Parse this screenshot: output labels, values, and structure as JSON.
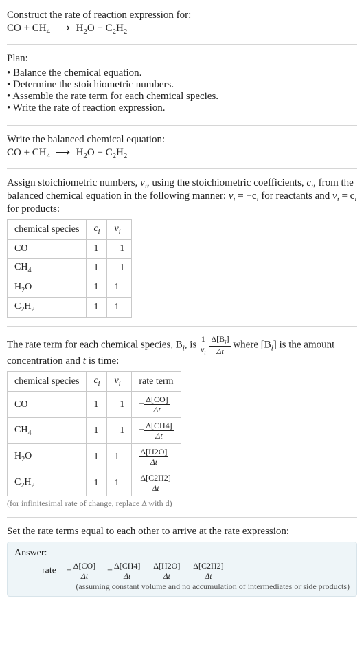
{
  "prompt": {
    "title": "Construct the rate of reaction expression for:",
    "equation_lhs1": "CO + CH",
    "equation_lhs1_sub": "4",
    "arrow": "⟶",
    "equation_rhs1": "H",
    "equation_rhs1_sub": "2",
    "equation_rhs2": "O + C",
    "equation_rhs2_sub": "2",
    "equation_rhs3": "H",
    "equation_rhs3_sub": "2"
  },
  "plan": {
    "heading": "Plan:",
    "items": [
      "Balance the chemical equation.",
      "Determine the stoichiometric numbers.",
      "Assemble the rate term for each chemical species.",
      "Write the rate of reaction expression."
    ]
  },
  "balanced": {
    "heading": "Write the balanced chemical equation:"
  },
  "stoich": {
    "text1": "Assign stoichiometric numbers, ",
    "nu": "ν",
    "sub_i": "i",
    "text2": ", using the stoichiometric coefficients, ",
    "c": "c",
    "text3": ", from the balanced chemical equation in the following manner: ",
    "eq1": "ν",
    "eq1b": " = −c",
    "text4": " for reactants and ",
    "eq2": "ν",
    "eq2b": " = c",
    "text5": " for products:",
    "headers": [
      "chemical species",
      "cᵢ",
      "νᵢ"
    ],
    "rows": [
      {
        "species_a": "CO",
        "species_b": "",
        "ci": "1",
        "nui": "−1"
      },
      {
        "species_a": "CH",
        "species_b": "4",
        "ci": "1",
        "nui": "−1"
      },
      {
        "species_a": "H",
        "species_b": "2",
        "species_c": "O",
        "ci": "1",
        "nui": "1"
      },
      {
        "species_a": "C",
        "species_b": "2",
        "species_c": "H",
        "species_d": "2",
        "ci": "1",
        "nui": "1"
      }
    ]
  },
  "rateterm": {
    "text1": "The rate term for each chemical species, B",
    "text2": ", is ",
    "frac1_num": "1",
    "frac1_den_a": "ν",
    "frac2_num_a": "Δ[B",
    "frac2_num_b": "]",
    "frac2_den": "Δt",
    "text3": " where [B",
    "text4": "] is the amount concentration and ",
    "tvar": "t",
    "text5": " is time:",
    "headers": [
      "chemical species",
      "cᵢ",
      "νᵢ",
      "rate term"
    ],
    "rows": [
      {
        "species_a": "CO",
        "ci": "1",
        "nui": "−1",
        "sign": "−",
        "num": "Δ[CO]",
        "den": "Δt"
      },
      {
        "species_a": "CH",
        "species_b": "4",
        "ci": "1",
        "nui": "−1",
        "sign": "−",
        "num": "Δ[CH4]",
        "den": "Δt"
      },
      {
        "species_a": "H",
        "species_b": "2",
        "species_c": "O",
        "ci": "1",
        "nui": "1",
        "sign": "",
        "num": "Δ[H2O]",
        "den": "Δt"
      },
      {
        "species_a": "C",
        "species_b": "2",
        "species_c": "H",
        "species_d": "2",
        "ci": "1",
        "nui": "1",
        "sign": "",
        "num": "Δ[C2H2]",
        "den": "Δt"
      }
    ],
    "caption": "(for infinitesimal rate of change, replace Δ with d)"
  },
  "final": {
    "heading": "Set the rate terms equal to each other to arrive at the rate expression:",
    "answer_label": "Answer:",
    "rate_word": "rate = ",
    "t1_sign": "−",
    "t1_num": "Δ[CO]",
    "t1_den": "Δt",
    "eq": " = ",
    "t2_sign": "−",
    "t2_num": "Δ[CH4]",
    "t2_den": "Δt",
    "t3_num": "Δ[H2O]",
    "t3_den": "Δt",
    "t4_num": "Δ[C2H2]",
    "t4_den": "Δt",
    "note": "(assuming constant volume and no accumulation of intermediates or side products)"
  },
  "chart_data": {
    "type": "table",
    "title": "Stoichiometric numbers and rate terms for CO + CH4 → H2O + C2H2",
    "columns": [
      "chemical species",
      "c_i",
      "nu_i",
      "rate term"
    ],
    "rows": [
      [
        "CO",
        1,
        -1,
        "-Δ[CO]/Δt"
      ],
      [
        "CH4",
        1,
        -1,
        "-Δ[CH4]/Δt"
      ],
      [
        "H2O",
        1,
        1,
        "Δ[H2O]/Δt"
      ],
      [
        "C2H2",
        1,
        1,
        "Δ[C2H2]/Δt"
      ]
    ],
    "rate_expression": "rate = -Δ[CO]/Δt = -Δ[CH4]/Δt = Δ[H2O]/Δt = Δ[C2H2]/Δt"
  }
}
